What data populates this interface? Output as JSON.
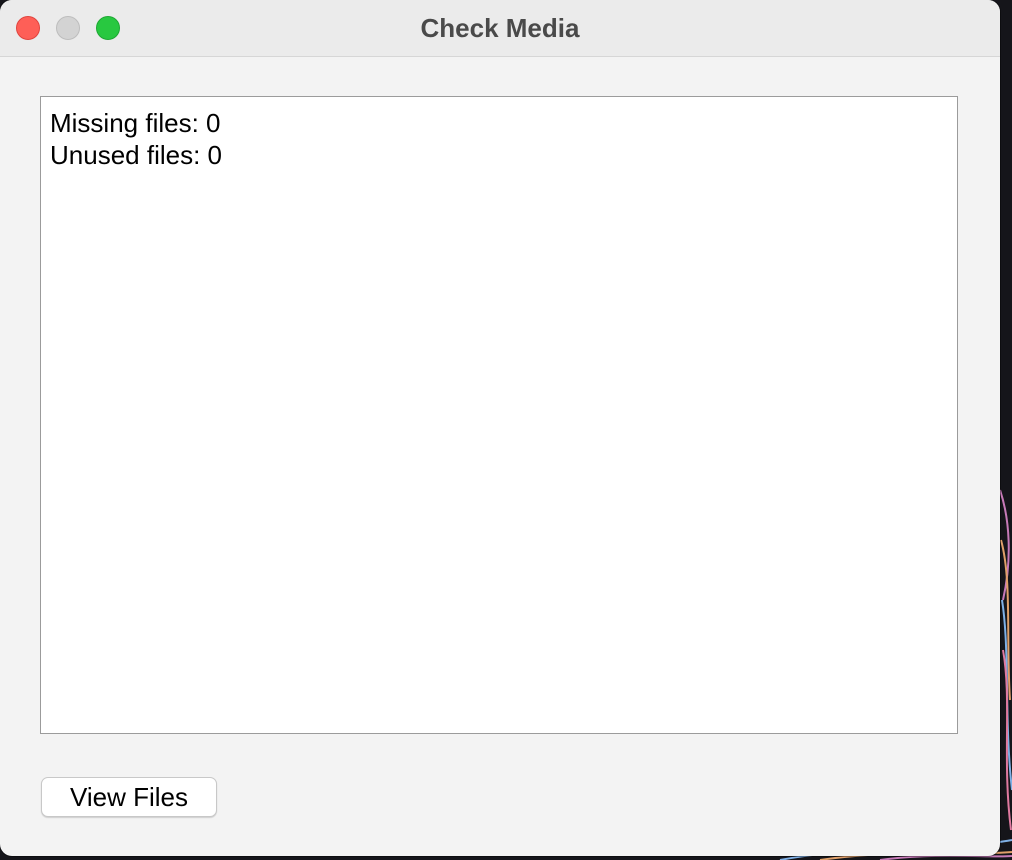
{
  "window": {
    "title": "Check Media"
  },
  "results": {
    "missing_files": "Missing files: 0",
    "unused_files": "Unused files: 0"
  },
  "buttons": {
    "view_files": "View Files"
  },
  "colors": {
    "close": "#fe5f57",
    "minimize": "#d3d3d3",
    "zoom": "#28c840",
    "window_bg": "#f3f3f3",
    "titlebar_bg": "#ebebeb"
  }
}
